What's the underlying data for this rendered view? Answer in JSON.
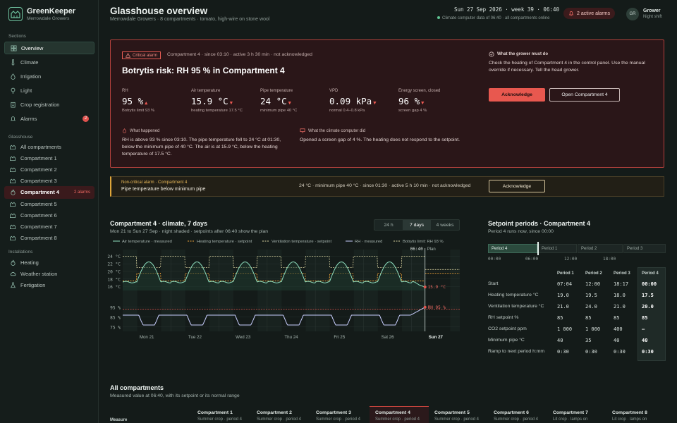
{
  "brand": {
    "name": "GreenKeeper",
    "sub": "Merrowdale Growers"
  },
  "sidebar": {
    "sections_label": "Sections",
    "sections": [
      {
        "label": "Overview",
        "icon": "overview-icon"
      },
      {
        "label": "Climate",
        "icon": "thermometer-icon"
      },
      {
        "label": "Irrigation",
        "icon": "droplet-icon"
      },
      {
        "label": "Light",
        "icon": "bulb-icon"
      },
      {
        "label": "Crop registration",
        "icon": "clipboard-icon"
      },
      {
        "label": "Alarms",
        "icon": "bell-icon",
        "badge": "2"
      }
    ],
    "glasshouse_label": "Glasshouse",
    "glasshouse": [
      {
        "label": "All compartments"
      },
      {
        "label": "Compartment 1"
      },
      {
        "label": "Compartment 2"
      },
      {
        "label": "Compartment 3"
      },
      {
        "label": "Compartment 4",
        "badge": "2 alarms"
      },
      {
        "label": "Compartment 5"
      },
      {
        "label": "Compartment 6"
      },
      {
        "label": "Compartment 7"
      },
      {
        "label": "Compartment 8"
      }
    ],
    "installations_label": "Installations",
    "installations": [
      {
        "label": "Heating"
      },
      {
        "label": "Weather station"
      },
      {
        "label": "Fertigation"
      }
    ]
  },
  "header": {
    "title": "Glasshouse overview",
    "sub": "Merrowdale Growers · 8 compartments · tomato, high-wire on stone wool",
    "date": "Sun 27 Sep 2026 · week 39 · 06:40",
    "cc_status": "Climate computer data of 06:40 · all compartments online",
    "alarms": "2 active alarms",
    "avatar": "GR",
    "user": "Grower",
    "role": "Night shift"
  },
  "critical": {
    "tag": "Critical alarm",
    "meta": "Compartment 4 · since 03:10 · active 3 h 30 min · not acknowledged",
    "title": "Botrytis risk: RH 95 % in Compartment 4",
    "metrics": [
      {
        "label": "RH",
        "value": "95 %",
        "sub": "Botrytis limit 93 %",
        "dir": "▲"
      },
      {
        "label": "Air temperature",
        "value": "15.9 °C",
        "sub": "heating temperature 17.5 °C",
        "dir": "▼"
      },
      {
        "label": "Pipe temperature",
        "value": "24 °C",
        "sub": "minimum pipe 40 °C",
        "dir": "▼"
      },
      {
        "label": "VPD",
        "value": "0.09 kPa",
        "sub": "normal 0.4–0.8 kPa",
        "dir": "▼"
      },
      {
        "label": "Energy screen, closed",
        "value": "96 %",
        "sub": "screen gap 4 %",
        "dir": "▼"
      }
    ],
    "happened_h": "What happened",
    "happened": "RH is above 93 % since 03:10. The pipe temperature fell to 24 °C at 01:30, below the minimum pipe of 40 °C. The air is at 15.9 °C, below the heating temperature of 17.5 °C.",
    "computer_h": "What the climate computer did",
    "computer": "Opened a screen gap of 4 %. The heating does not respond to the setpoint.",
    "grower_h": "What the grower must do",
    "grower": "Check the heating of Compartment 4 in the control panel. Use the manual override if necessary. Tell the head grower.",
    "ack": "Acknowledge",
    "open": "Open Compartment 4"
  },
  "noncritical": {
    "tag": "Non-critical alarm · Compartment 4",
    "msg": "Pipe temperature below minimum pipe",
    "meta": "24 °C · minimum pipe 40 °C · since 01:30 · active 5 h 10 min · not acknowledged",
    "ack": "Acknowledge"
  },
  "chart_section": {
    "title": "Compartment 4 · climate, 7 days",
    "sub": "Mon 21 to Sun 27 Sep · night shaded · setpoints after 06:40 show the plan",
    "ranges": [
      "24 h",
      "7 days",
      "4 weeks"
    ],
    "active_range": "7 days"
  },
  "chart_data": {
    "type": "line",
    "legend": [
      "Air temperature · measured",
      "Heating temperature · setpoint",
      "Ventilation temperature · setpoint",
      "RH · measured",
      "Botrytis limit: RH 93 %"
    ],
    "x_labels": [
      "Mon 21",
      "Tue 22",
      "Wed 23",
      "Thu 24",
      "Fri 25",
      "Sat 26",
      "Sun 27"
    ],
    "temp_ticks": [
      "24 °C",
      "22 °C",
      "20 °C",
      "18 °C",
      "16 °C"
    ],
    "rh_ticks": [
      "95 %",
      "85 %",
      "75 %"
    ],
    "temp_range": [
      15,
      25
    ],
    "rh_range": [
      72,
      97
    ],
    "now_label": "06:40",
    "plan_label": "Plan",
    "air_label": "15.9 °C",
    "rh_label": "RH 95 %",
    "botrytis_label": "Botrytis limit: RH 93 %",
    "air_day_max": 22.5,
    "air_night_min": 17.2,
    "air_now": 15.9,
    "heat_day": 19.5,
    "heat_night": 17.5,
    "vent_day": 21,
    "vent_night": 24,
    "rh_day": 77,
    "rh_night": 87,
    "rh_now": 95,
    "botrytis_limit": 93
  },
  "setpoints": {
    "title": "Setpoint periods · Compartment 4",
    "sub": "Period 4 runs now, since 00:00",
    "timeline": [
      "Period 4",
      "Period 1",
      "Period 2",
      "Period 3"
    ],
    "times": [
      "00:00",
      "06:00",
      "12:00",
      "18:00"
    ],
    "columns": [
      "Period 1",
      "Period 2",
      "Period 3",
      "Period 4"
    ],
    "rows": [
      {
        "label": "Start",
        "values": [
          "07:04",
          "12:00",
          "18:17",
          "00:00"
        ]
      },
      {
        "label": "Heating temperature °C",
        "values": [
          "19.0",
          "19.5",
          "18.0",
          "17.5"
        ]
      },
      {
        "label": "Ventilation temperature °C",
        "values": [
          "21.0",
          "24.0",
          "21.0",
          "20.0"
        ]
      },
      {
        "label": "RH setpoint %",
        "values": [
          "85",
          "85",
          "85",
          "85"
        ]
      },
      {
        "label": "CO2 setpoint ppm",
        "values": [
          "1 000",
          "1 000",
          "400",
          "–"
        ]
      },
      {
        "label": "Minimum pipe °C",
        "values": [
          "40",
          "35",
          "40",
          "40"
        ]
      },
      {
        "label": "Ramp to next period h:mm",
        "values": [
          "0:30",
          "0:30",
          "0:30",
          "0:30"
        ]
      }
    ]
  },
  "compartments": {
    "title": "All compartments",
    "sub": "Measured value at 06:40, with its setpoint or its normal range",
    "measure": "Measure",
    "cols": [
      {
        "name": "Compartment 1",
        "crop": "Summer crop · period 4"
      },
      {
        "name": "Compartment 2",
        "crop": "Summer crop · period 4"
      },
      {
        "name": "Compartment 3",
        "crop": "Summer crop · period 4"
      },
      {
        "name": "Compartment 4",
        "crop": "Summer crop · period 4"
      },
      {
        "name": "Compartment 5",
        "crop": "Summer crop · period 4"
      },
      {
        "name": "Compartment 6",
        "crop": "Summer crop · period 4"
      },
      {
        "name": "Compartment 7",
        "crop": "Lit crop · lamps on"
      },
      {
        "name": "Compartment 8",
        "crop": "Lit crop · lamps on"
      }
    ]
  }
}
